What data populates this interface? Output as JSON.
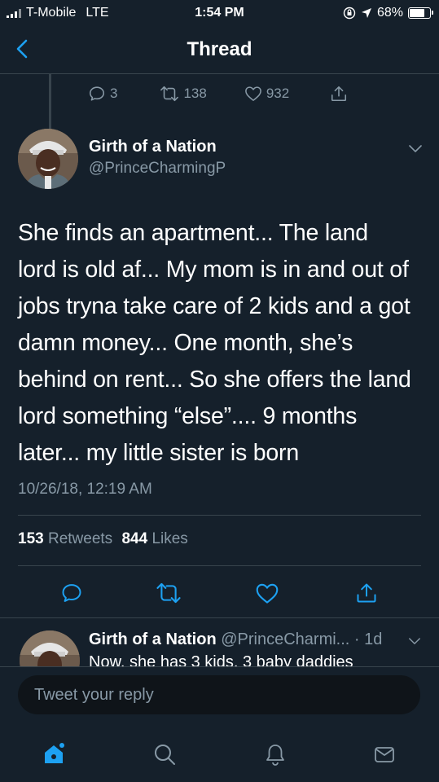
{
  "status_bar": {
    "carrier": "T-Mobile",
    "network": "LTE",
    "time": "1:54 PM",
    "battery": "68%",
    "icons": [
      "signal-icon",
      "rotation-lock-icon",
      "location-arrow-icon",
      "battery-icon"
    ]
  },
  "nav": {
    "back_icon": "chevron-left-icon",
    "title": "Thread"
  },
  "previous_tweet_actions": {
    "replies": "3",
    "retweets": "138",
    "likes": "932"
  },
  "tweet": {
    "author_name": "Girth of a Nation",
    "handle": "@PrinceCharmingP",
    "lines": [
      "She finds an apartment... The land",
      "lord is old af... My mom is in and out of",
      "jobs tryna take care of 2 kids and a got",
      "damn money... One month, she’s",
      "behind on rent... So she offers the land",
      "lord something “else”.... 9 months",
      "later... my little sister is born"
    ],
    "timestamp": "10/26/18, 12:19 AM",
    "retweet_count": "153",
    "retweets_label": "Retweets",
    "like_count": "844",
    "likes_label": "Likes"
  },
  "reply_preview": {
    "author_name": "Girth of a Nation",
    "meta": "@PrinceCharmi... · 1d",
    "text": "Now, she has 3 kids, 3 baby daddies"
  },
  "compose": {
    "placeholder": "Tweet your reply"
  },
  "tabs": [
    "home-icon",
    "search-icon",
    "notifications-icon",
    "messages-icon"
  ],
  "colors": {
    "background": "#15202b",
    "secondary_text": "#8899a6",
    "accent": "#1da1f2",
    "divider": "#38444d",
    "input_bg": "#0f1419"
  }
}
